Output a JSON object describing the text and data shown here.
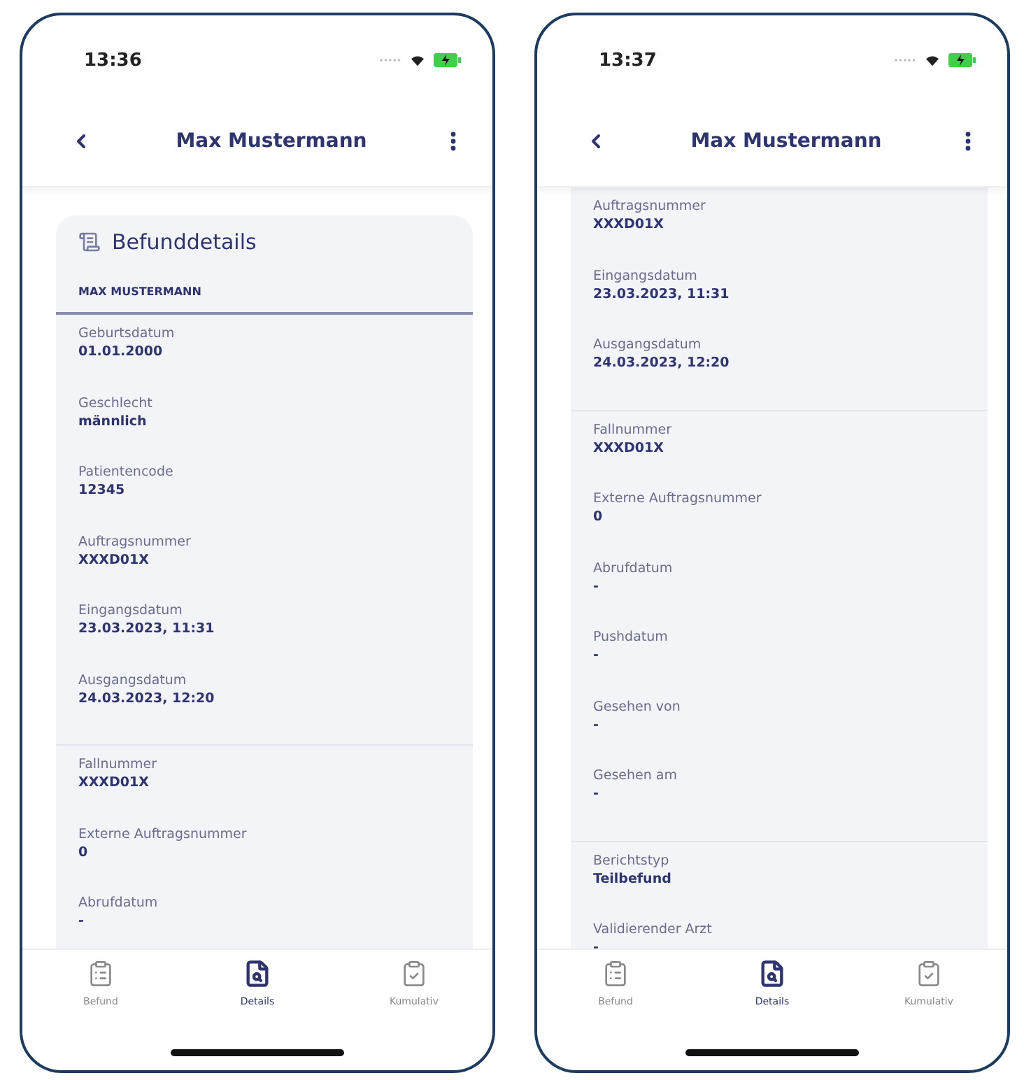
{
  "screens": [
    {
      "status_bar": {
        "time": "13:36"
      },
      "header": {
        "title": "Max Mustermann"
      },
      "card": {
        "title": "Befunddetails",
        "section_header": "MAX MUSTERMANN",
        "groups": [
          [
            {
              "label": "Geburtsdatum",
              "value": "01.01.2000"
            },
            {
              "label": "Geschlecht",
              "value": "männlich"
            },
            {
              "label": "Patientencode",
              "value": "12345"
            },
            {
              "label": "Auftragsnummer",
              "value": "XXXD01X"
            },
            {
              "label": "Eingangsdatum",
              "value": "23.03.2023, 11:31"
            },
            {
              "label": "Ausgangsdatum",
              "value": "24.03.2023, 12:20"
            }
          ],
          [
            {
              "label": "Fallnummer",
              "value": "XXXD01X"
            },
            {
              "label": "Externe Auftragsnummer",
              "value": "0"
            },
            {
              "label": "Abrufdatum",
              "value": "-"
            }
          ]
        ]
      },
      "tabs": [
        {
          "label": "Befund",
          "selected": false
        },
        {
          "label": "Details",
          "selected": true
        },
        {
          "label": "Kumulativ",
          "selected": false
        }
      ]
    },
    {
      "status_bar": {
        "time": "13:37"
      },
      "header": {
        "title": "Max Mustermann"
      },
      "card": {
        "groups": [
          [
            {
              "label": "Auftragsnummer",
              "value": "XXXD01X"
            },
            {
              "label": "Eingangsdatum",
              "value": "23.03.2023, 11:31"
            },
            {
              "label": "Ausgangsdatum",
              "value": "24.03.2023, 12:20"
            }
          ],
          [
            {
              "label": "Fallnummer",
              "value": "XXXD01X"
            },
            {
              "label": "Externe Auftragsnummer",
              "value": "0"
            },
            {
              "label": "Abrufdatum",
              "value": "-"
            },
            {
              "label": "Pushdatum",
              "value": "-"
            },
            {
              "label": "Gesehen von",
              "value": "-"
            },
            {
              "label": "Gesehen am",
              "value": "-"
            }
          ],
          [
            {
              "label": "Berichtstyp",
              "value": "Teilbefund"
            },
            {
              "label": "Validierender Arzt",
              "value": "-"
            }
          ]
        ]
      },
      "tabs": [
        {
          "label": "Befund",
          "selected": false
        },
        {
          "label": "Details",
          "selected": true
        },
        {
          "label": "Kumulativ",
          "selected": false
        }
      ]
    }
  ]
}
